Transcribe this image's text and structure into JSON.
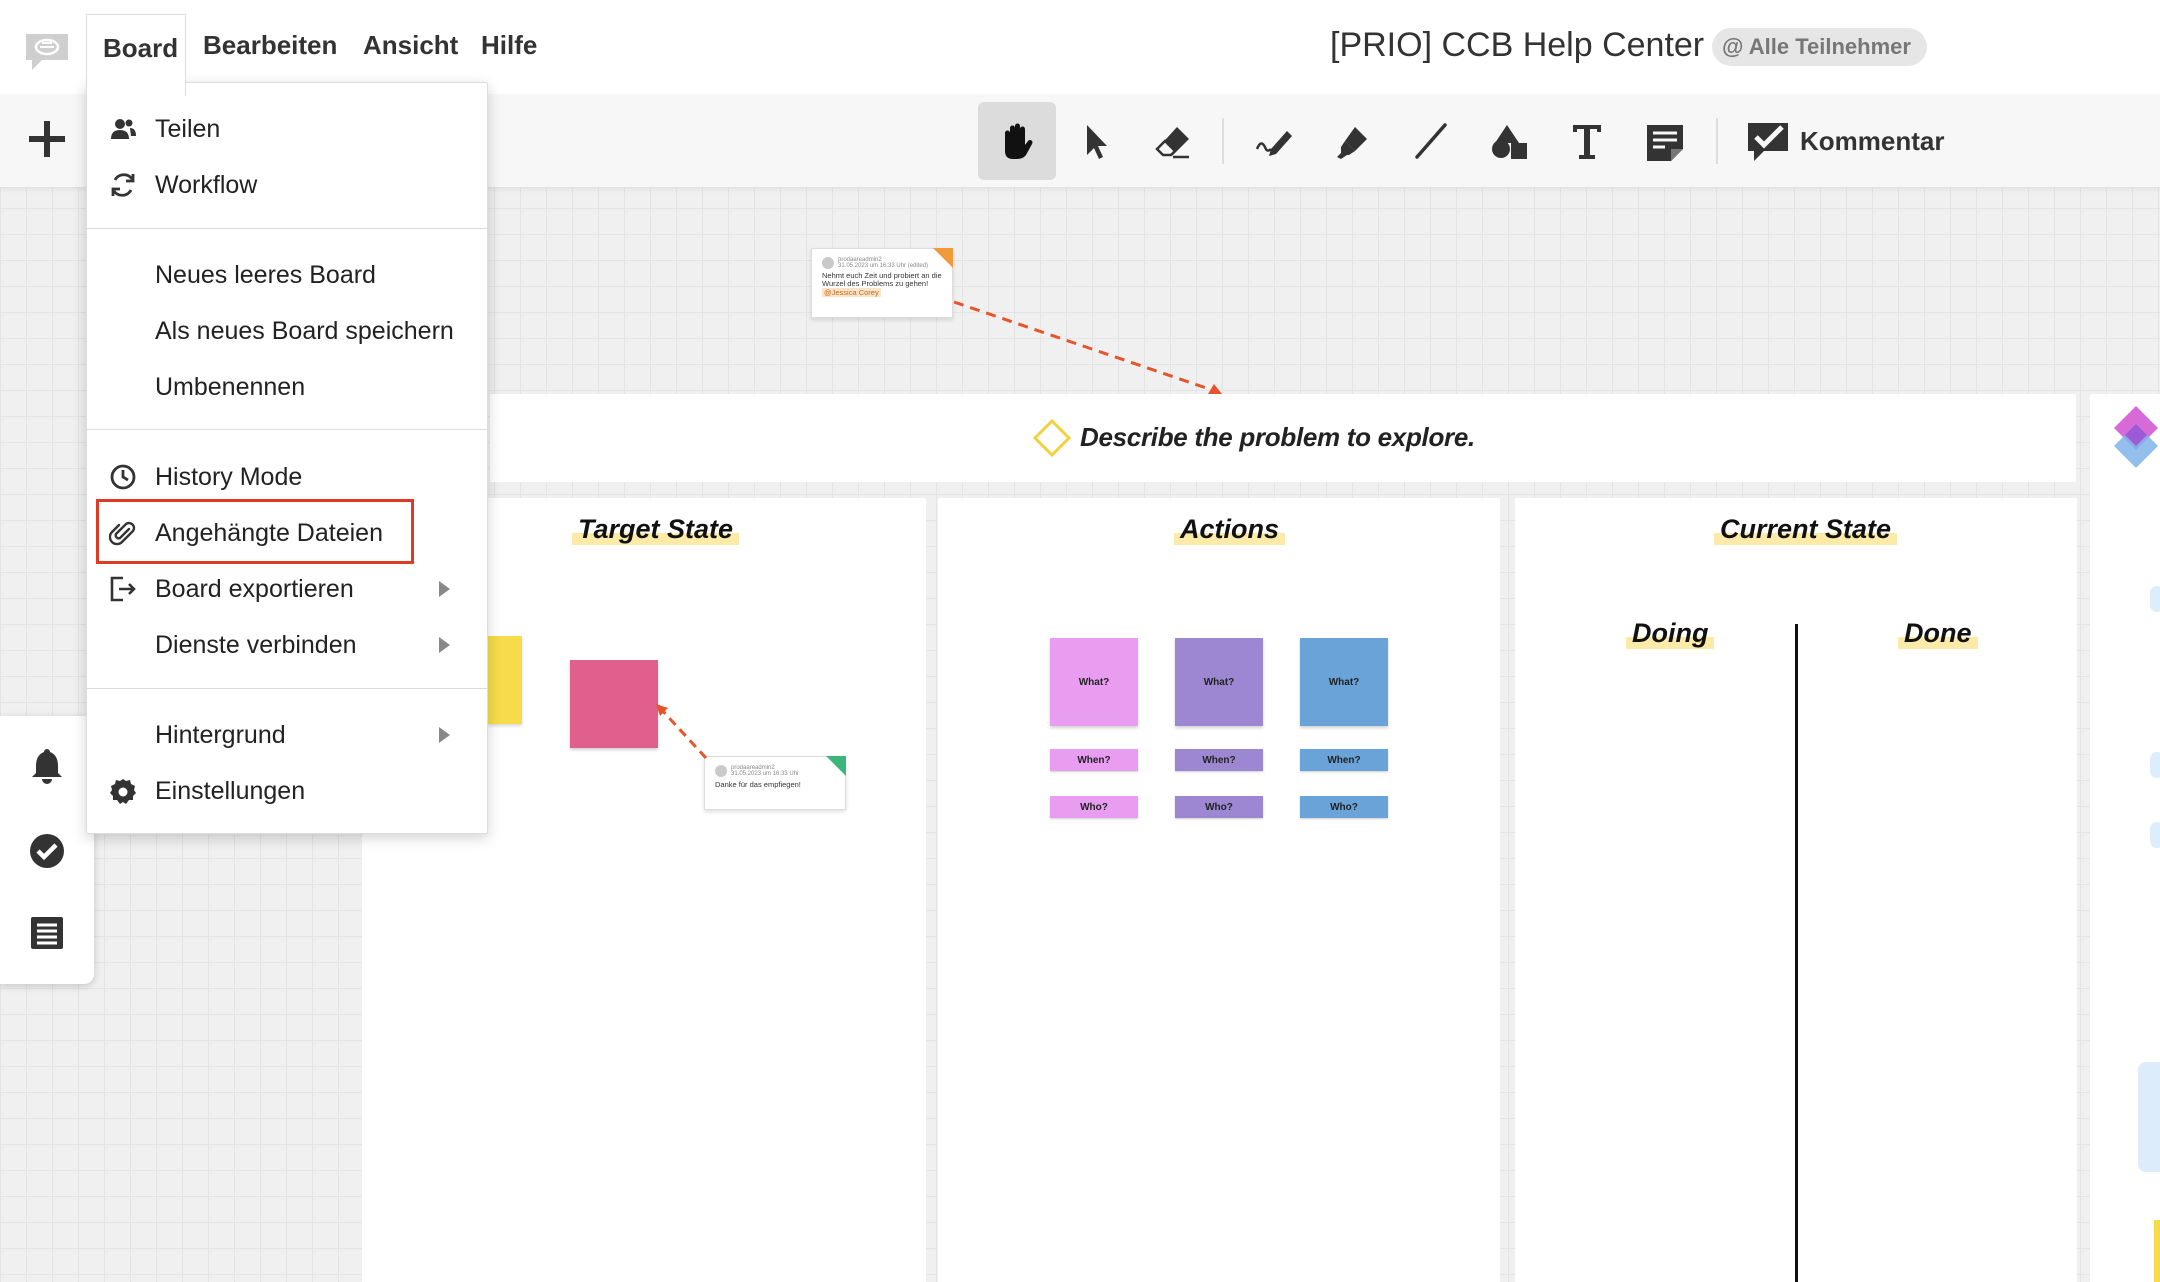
{
  "menubar": {
    "menus": [
      "Board",
      "Bearbeiten",
      "Ansicht",
      "Hilfe"
    ],
    "board_title": "[PRIO] CCB Help Center",
    "participants": "@ Alle Teilnehmer"
  },
  "toolbar": {
    "tools": [
      "hand-icon",
      "select-arrow-icon",
      "eraser-icon",
      "pen-icon",
      "highlighter-icon",
      "line-icon",
      "shapes-icon",
      "text-icon",
      "sticky-note-icon"
    ],
    "active_tool": "hand-icon",
    "comment_label": "Kommentar"
  },
  "board_menu": {
    "section1": [
      {
        "label": "Teilen",
        "icon": "share-people-icon"
      },
      {
        "label": "Workflow",
        "icon": "workflow-cycle-icon"
      }
    ],
    "section2": [
      {
        "label": "Neues leeres Board"
      },
      {
        "label": "Als neues Board speichern"
      },
      {
        "label": "Umbenennen"
      }
    ],
    "section3": [
      {
        "label": "History Mode",
        "icon": "clock-icon"
      },
      {
        "label": "Angehängte Dateien",
        "icon": "paperclip-icon",
        "highlighted": true
      },
      {
        "label": "Board exportieren",
        "icon": "export-icon",
        "submenu": true
      },
      {
        "label": "Dienste verbinden",
        "submenu": true
      }
    ],
    "section4": [
      {
        "label": "Hintergrund",
        "submenu": true
      },
      {
        "label": "Einstellungen",
        "icon": "gear-icon"
      }
    ]
  },
  "canvas": {
    "problem_prompt": "Describe the problem to explore.",
    "columns": {
      "target": "Target State",
      "actions": "Actions",
      "current": "Current State"
    },
    "current_subcolumns": {
      "doing": "Doing",
      "done": "Done"
    },
    "action_stickies": {
      "what": "What?",
      "when": "When?",
      "who": "Who?"
    },
    "comment_top": {
      "author": "prodaareadmin2",
      "date": "31.05.2023 um 16:33 Uhr (edited)",
      "text": "Nehmt euch Zeit und probiert an die Wurzel des Problems zu gehen!",
      "mention": "@Jessica Corey"
    },
    "comment_bottom": {
      "author": "prodaareadmin2",
      "date": "31.05.2023 um 16:33 Uhr",
      "text": "Danke für das empfiegen!"
    },
    "colors": {
      "pink": "#e89df0",
      "purple": "#9d86d2",
      "blue": "#6aa3d8",
      "yellow": "#f6dc4b",
      "rose": "#e05f8d"
    }
  },
  "left_dock": [
    "bell-icon",
    "check-circle-icon",
    "list-icon"
  ]
}
